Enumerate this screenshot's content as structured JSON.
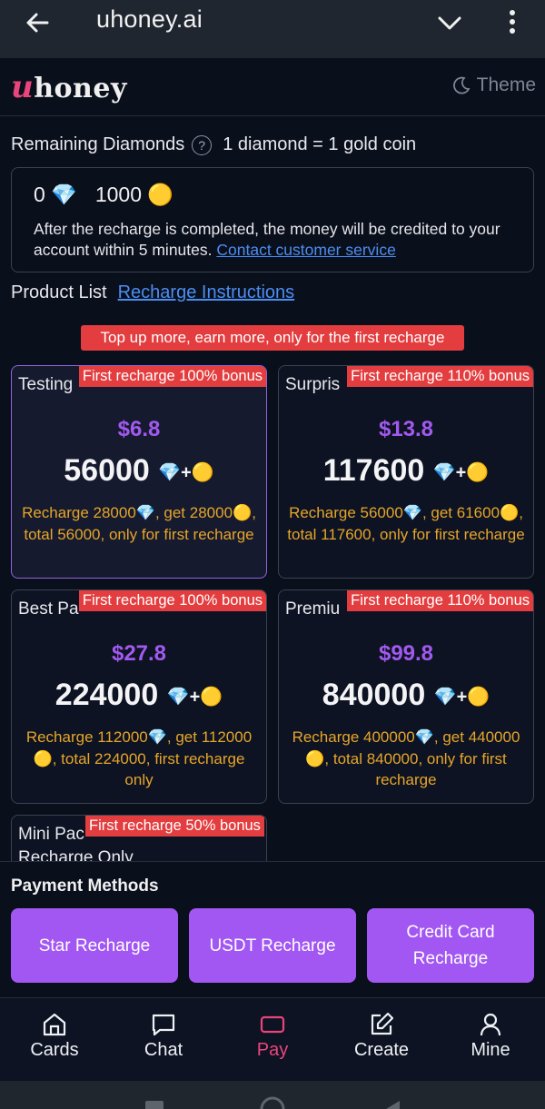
{
  "browser": {
    "url": "uhoney.ai"
  },
  "header": {
    "logo_accent": "u",
    "logo_rest": "honey",
    "theme_label": "Theme"
  },
  "remaining": {
    "label": "Remaining Diamonds",
    "help": "?",
    "rate": "1 diamond = 1 gold coin"
  },
  "balance": {
    "diamonds": "0",
    "coins": "1000",
    "note": "After the recharge is completed, the money will be credited to your account within 5 minutes.",
    "contact_link": "Contact customer service"
  },
  "products_header": {
    "label": "Product List",
    "link": "Recharge Instructions"
  },
  "promo_banner": "Top up more, earn more, only for the first recharge",
  "products": [
    {
      "name": "Testing",
      "bonus": "First recharge 100% bonus",
      "price": "$6.8",
      "amount": "56000",
      "desc": "Recharge 28000💎, get 28000🟡, total 56000, only for first recharge"
    },
    {
      "name": "Surpris",
      "bonus": "First recharge 110% bonus",
      "price": "$13.8",
      "amount": "117600",
      "desc": "Recharge 56000💎, get 61600🟡, total 117600, only for first recharge"
    },
    {
      "name": "Best Pa",
      "bonus": "First recharge 100% bonus",
      "price": "$27.8",
      "amount": "224000",
      "desc": "Recharge 112000💎, get 112000🟡, total 224000, first recharge only"
    },
    {
      "name": "Premiu",
      "bonus": "First recharge 110% bonus",
      "price": "$99.8",
      "amount": "840000",
      "desc": "Recharge 400000💎, get 440000🟡, total 840000, only for first recharge"
    }
  ],
  "mini_product": {
    "name": "Mini Pac",
    "sub": "Recharge Only",
    "bonus": "First recharge 50% bonus"
  },
  "amount_suffix": "💎+🟡",
  "diamond": "💎",
  "coin": "🟡",
  "payment": {
    "title": "Payment Methods",
    "methods": [
      "Star Recharge",
      "USDT Recharge",
      "Credit Card Recharge"
    ]
  },
  "nav": {
    "items": [
      "Cards",
      "Chat",
      "Pay",
      "Create",
      "Mine"
    ],
    "active": "Pay",
    "active_color": "#e9457c"
  },
  "colors": {
    "accent": "#a257f3",
    "bonus": "#e33d3f",
    "price": "#a259f0",
    "desc": "#e6a52a"
  }
}
